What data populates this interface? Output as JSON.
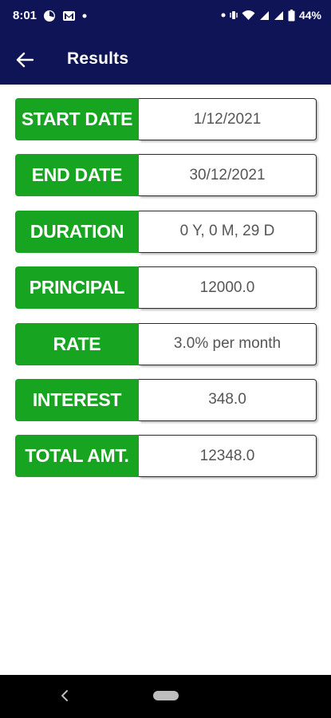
{
  "status_bar": {
    "time": "8:01",
    "battery": "44%",
    "icons": [
      "pie-chart-icon",
      "gmail-icon",
      "dot-icon",
      "dot-icon",
      "vibrate-icon",
      "wifi-icon",
      "signal-icon",
      "signal-icon",
      "battery-icon"
    ]
  },
  "app_bar": {
    "title": "Results",
    "back_icon": "arrow-left-icon"
  },
  "results": [
    {
      "label": "START DATE",
      "value": "1/12/2021"
    },
    {
      "label": "END DATE",
      "value": "30/12/2021"
    },
    {
      "label": "DURATION",
      "value": "0 Y, 0 M, 29 D"
    },
    {
      "label": "PRINCIPAL",
      "value": "12000.0"
    },
    {
      "label": "RATE",
      "value": "3.0% per month"
    },
    {
      "label": "INTEREST",
      "value": "348.0"
    },
    {
      "label": "TOTAL AMT.",
      "value": "12348.0"
    }
  ],
  "colors": {
    "header": "#0f1456",
    "label_background": "#17a420",
    "value_text": "#555555",
    "nav_bar": "#000000"
  }
}
